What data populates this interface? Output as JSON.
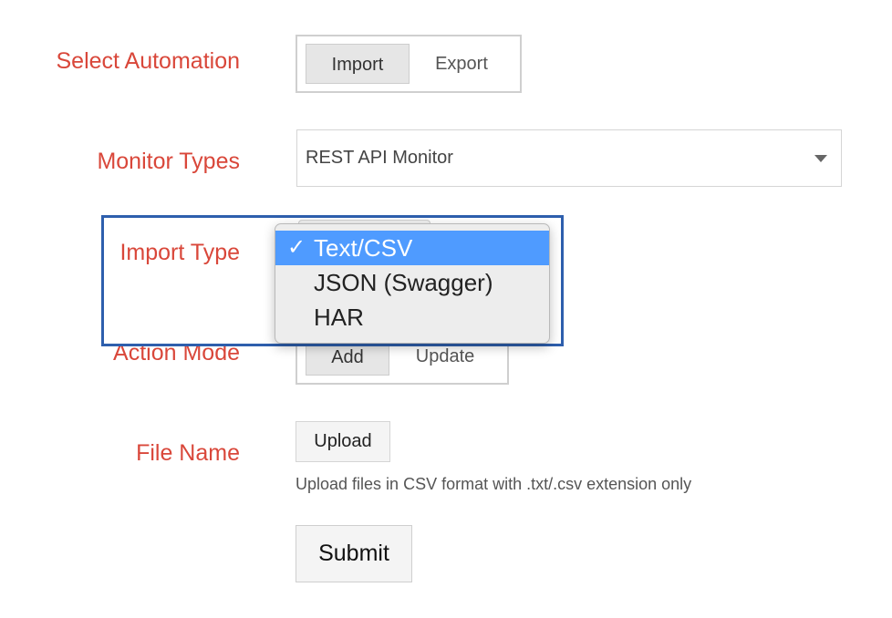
{
  "form": {
    "select_automation": {
      "label": "Select Automation",
      "options": [
        "Import",
        "Export"
      ],
      "selected": "Import"
    },
    "monitor_types": {
      "label": "Monitor Types",
      "value": "REST API Monitor"
    },
    "import_type": {
      "label": "Import Type",
      "dropdown_options": [
        "Text/CSV",
        "JSON (Swagger)",
        "HAR"
      ],
      "selected": "Text/CSV",
      "check_mark": "✓"
    },
    "action_mode": {
      "label": "Action Mode",
      "options": [
        "Add",
        "Update"
      ],
      "selected": "Add"
    },
    "file_name": {
      "label": "File Name",
      "upload_label": "Upload",
      "hint": "Upload files in CSV format with .txt/.csv extension only"
    },
    "submit_label": "Submit"
  },
  "colors": {
    "label_red": "#d9473a",
    "highlight_blue": "#2e5fad",
    "selection_blue": "#4f9bff"
  }
}
